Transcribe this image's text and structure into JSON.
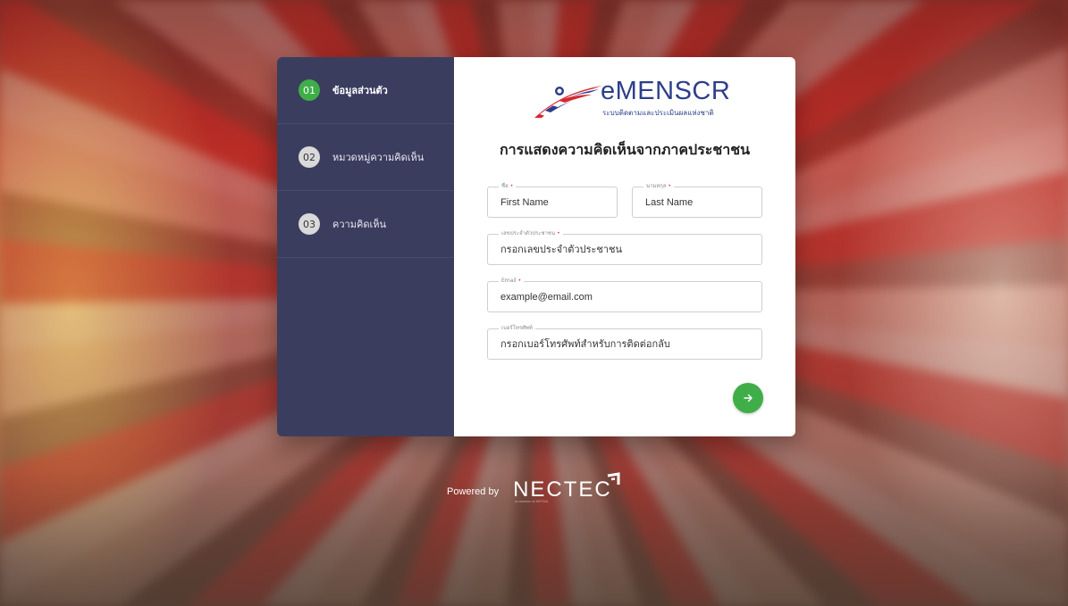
{
  "sidebar": {
    "steps": [
      {
        "number": "01",
        "label": "ข้อมูลส่วนตัว"
      },
      {
        "number": "02",
        "label": "หมวดหมู่ความคิดเห็น"
      },
      {
        "number": "03",
        "label": "ความคิดเห็น"
      }
    ]
  },
  "logo": {
    "title": "eMENSCR",
    "subtitle": "ระบบติดตามและประเมินผลแห่งชาติ"
  },
  "form": {
    "title": "การแสดงความคิดเห็นจากภาคประชาชน",
    "first_name": {
      "label": "ชื่อ",
      "required": "•",
      "placeholder": "First Name"
    },
    "last_name": {
      "label": "นามสกุล",
      "required": "•",
      "placeholder": "Last Name"
    },
    "citizen_id": {
      "label": "เลขประจำตัวประชาชน",
      "required": "•",
      "placeholder": "กรอกเลขประจำตัวประชาชน"
    },
    "email": {
      "label": "Email",
      "required": "•",
      "placeholder": "example@email.com"
    },
    "phone": {
      "label": "เบอร์โทรศัพท์",
      "placeholder": "กรอกเบอร์โทรศัพท์สำหรับการติดต่อกลับ"
    },
    "next_icon": "arrow-right-icon"
  },
  "footer": {
    "powered_by": "Powered by",
    "brand": "NECTEC",
    "brand_tagline": "a member of NSTDA"
  },
  "colors": {
    "sidebar_bg": "#3b3d5f",
    "accent_green": "#3fae49",
    "logo_blue": "#2c3e8a",
    "required_red": "#e23b3b"
  }
}
